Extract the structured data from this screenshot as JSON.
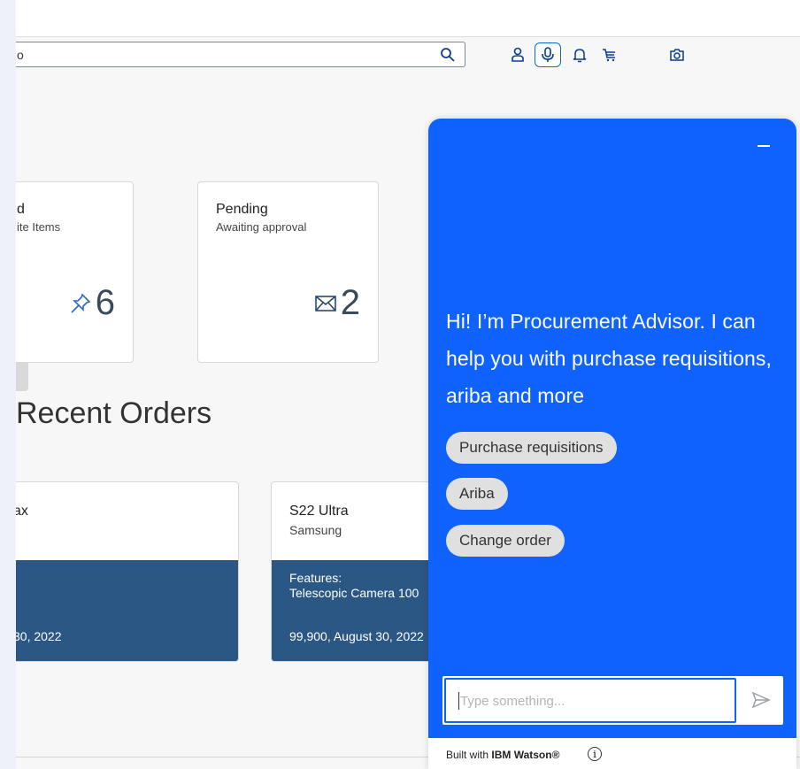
{
  "header": {
    "search_value": "o",
    "icons": [
      "search-icon",
      "user-icon",
      "microphone-icon",
      "bell-icon",
      "cart-icon",
      "camera-icon"
    ]
  },
  "tiles": [
    {
      "title": "d",
      "subtitle": "ite Items",
      "count": "6",
      "icon": "pin-icon"
    },
    {
      "title": "Pending",
      "subtitle": "Awaiting approval",
      "count": "2",
      "icon": "mail-icon"
    }
  ],
  "recent": {
    "heading": "Recent Orders",
    "cards": [
      {
        "name": "ax",
        "brand": "",
        "band_line1": "",
        "band_line2": "",
        "band_price": "30, 2022"
      },
      {
        "name": "S22 Ultra",
        "brand": "Samsung",
        "band_line1": "Features:",
        "band_line2": "Telescopic Camera 100",
        "band_price": "99,900, August 30, 2022"
      }
    ]
  },
  "chat": {
    "message": "Hi! I’m Procurement Advisor. I can help you with purchase requisitions, ariba and more",
    "chips": [
      "Purchase requisitions",
      "Ariba",
      "Change order"
    ],
    "input_placeholder": "Type something...",
    "footer_prefix": "Built with ",
    "footer_brand": "IBM Watson®",
    "info_glyph": "i"
  },
  "colors": {
    "accent": "#0f62fe",
    "card_band": "#2b5785",
    "chip": "#e0e0e0"
  }
}
